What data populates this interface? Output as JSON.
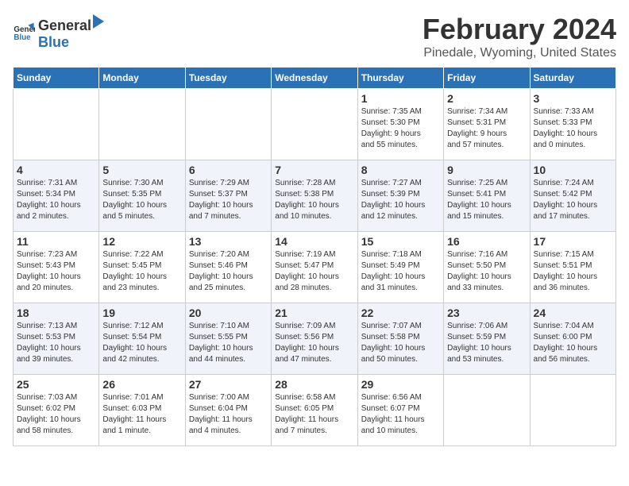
{
  "header": {
    "logo_general": "General",
    "logo_blue": "Blue",
    "month": "February 2024",
    "location": "Pinedale, Wyoming, United States"
  },
  "days_of_week": [
    "Sunday",
    "Monday",
    "Tuesday",
    "Wednesday",
    "Thursday",
    "Friday",
    "Saturday"
  ],
  "weeks": [
    [
      {
        "day": "",
        "info": ""
      },
      {
        "day": "",
        "info": ""
      },
      {
        "day": "",
        "info": ""
      },
      {
        "day": "",
        "info": ""
      },
      {
        "day": "1",
        "info": "Sunrise: 7:35 AM\nSunset: 5:30 PM\nDaylight: 9 hours\nand 55 minutes."
      },
      {
        "day": "2",
        "info": "Sunrise: 7:34 AM\nSunset: 5:31 PM\nDaylight: 9 hours\nand 57 minutes."
      },
      {
        "day": "3",
        "info": "Sunrise: 7:33 AM\nSunset: 5:33 PM\nDaylight: 10 hours\nand 0 minutes."
      }
    ],
    [
      {
        "day": "4",
        "info": "Sunrise: 7:31 AM\nSunset: 5:34 PM\nDaylight: 10 hours\nand 2 minutes."
      },
      {
        "day": "5",
        "info": "Sunrise: 7:30 AM\nSunset: 5:35 PM\nDaylight: 10 hours\nand 5 minutes."
      },
      {
        "day": "6",
        "info": "Sunrise: 7:29 AM\nSunset: 5:37 PM\nDaylight: 10 hours\nand 7 minutes."
      },
      {
        "day": "7",
        "info": "Sunrise: 7:28 AM\nSunset: 5:38 PM\nDaylight: 10 hours\nand 10 minutes."
      },
      {
        "day": "8",
        "info": "Sunrise: 7:27 AM\nSunset: 5:39 PM\nDaylight: 10 hours\nand 12 minutes."
      },
      {
        "day": "9",
        "info": "Sunrise: 7:25 AM\nSunset: 5:41 PM\nDaylight: 10 hours\nand 15 minutes."
      },
      {
        "day": "10",
        "info": "Sunrise: 7:24 AM\nSunset: 5:42 PM\nDaylight: 10 hours\nand 17 minutes."
      }
    ],
    [
      {
        "day": "11",
        "info": "Sunrise: 7:23 AM\nSunset: 5:43 PM\nDaylight: 10 hours\nand 20 minutes."
      },
      {
        "day": "12",
        "info": "Sunrise: 7:22 AM\nSunset: 5:45 PM\nDaylight: 10 hours\nand 23 minutes."
      },
      {
        "day": "13",
        "info": "Sunrise: 7:20 AM\nSunset: 5:46 PM\nDaylight: 10 hours\nand 25 minutes."
      },
      {
        "day": "14",
        "info": "Sunrise: 7:19 AM\nSunset: 5:47 PM\nDaylight: 10 hours\nand 28 minutes."
      },
      {
        "day": "15",
        "info": "Sunrise: 7:18 AM\nSunset: 5:49 PM\nDaylight: 10 hours\nand 31 minutes."
      },
      {
        "day": "16",
        "info": "Sunrise: 7:16 AM\nSunset: 5:50 PM\nDaylight: 10 hours\nand 33 minutes."
      },
      {
        "day": "17",
        "info": "Sunrise: 7:15 AM\nSunset: 5:51 PM\nDaylight: 10 hours\nand 36 minutes."
      }
    ],
    [
      {
        "day": "18",
        "info": "Sunrise: 7:13 AM\nSunset: 5:53 PM\nDaylight: 10 hours\nand 39 minutes."
      },
      {
        "day": "19",
        "info": "Sunrise: 7:12 AM\nSunset: 5:54 PM\nDaylight: 10 hours\nand 42 minutes."
      },
      {
        "day": "20",
        "info": "Sunrise: 7:10 AM\nSunset: 5:55 PM\nDaylight: 10 hours\nand 44 minutes."
      },
      {
        "day": "21",
        "info": "Sunrise: 7:09 AM\nSunset: 5:56 PM\nDaylight: 10 hours\nand 47 minutes."
      },
      {
        "day": "22",
        "info": "Sunrise: 7:07 AM\nSunset: 5:58 PM\nDaylight: 10 hours\nand 50 minutes."
      },
      {
        "day": "23",
        "info": "Sunrise: 7:06 AM\nSunset: 5:59 PM\nDaylight: 10 hours\nand 53 minutes."
      },
      {
        "day": "24",
        "info": "Sunrise: 7:04 AM\nSunset: 6:00 PM\nDaylight: 10 hours\nand 56 minutes."
      }
    ],
    [
      {
        "day": "25",
        "info": "Sunrise: 7:03 AM\nSunset: 6:02 PM\nDaylight: 10 hours\nand 58 minutes."
      },
      {
        "day": "26",
        "info": "Sunrise: 7:01 AM\nSunset: 6:03 PM\nDaylight: 11 hours\nand 1 minute."
      },
      {
        "day": "27",
        "info": "Sunrise: 7:00 AM\nSunset: 6:04 PM\nDaylight: 11 hours\nand 4 minutes."
      },
      {
        "day": "28",
        "info": "Sunrise: 6:58 AM\nSunset: 6:05 PM\nDaylight: 11 hours\nand 7 minutes."
      },
      {
        "day": "29",
        "info": "Sunrise: 6:56 AM\nSunset: 6:07 PM\nDaylight: 11 hours\nand 10 minutes."
      },
      {
        "day": "",
        "info": ""
      },
      {
        "day": "",
        "info": ""
      }
    ]
  ]
}
